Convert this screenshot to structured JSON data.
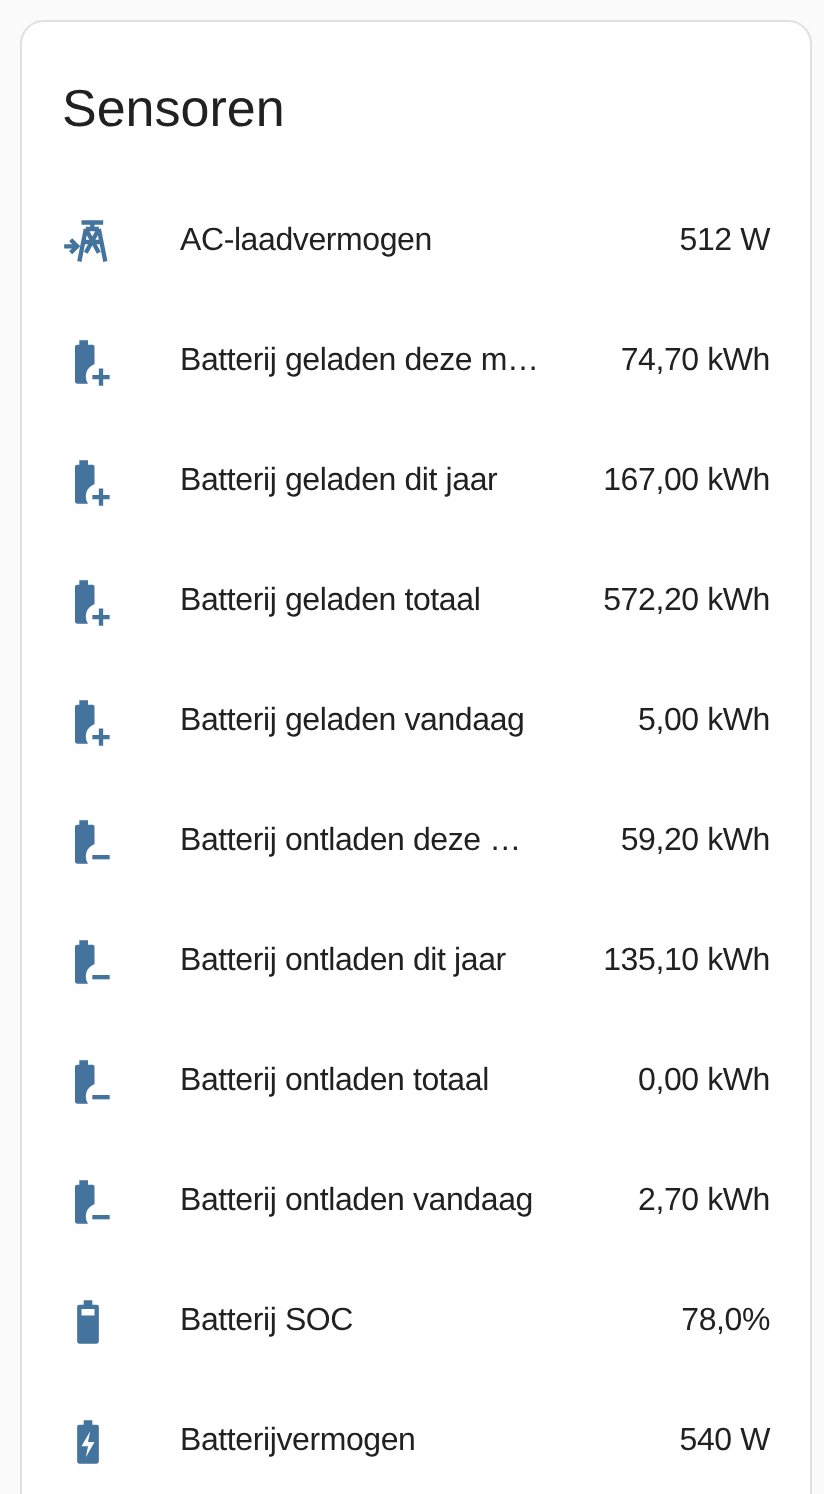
{
  "card": {
    "title": "Sensoren",
    "rows": [
      {
        "kind": "tower",
        "name": "AC-laadvermogen",
        "value": "512 W"
      },
      {
        "kind": "charge",
        "name": "Batterij geladen deze m…",
        "value": "74,70 kWh"
      },
      {
        "kind": "charge",
        "name": "Batterij geladen dit jaar",
        "value": "167,00 kWh"
      },
      {
        "kind": "charge",
        "name": "Batterij geladen totaal",
        "value": "572,20 kWh"
      },
      {
        "kind": "charge",
        "name": "Batterij geladen vandaag",
        "value": "5,00 kWh"
      },
      {
        "kind": "discharge",
        "name": "Batterij ontladen deze …",
        "value": "59,20 kWh"
      },
      {
        "kind": "discharge",
        "name": "Batterij ontladen dit jaar",
        "value": "135,10 kWh"
      },
      {
        "kind": "discharge",
        "name": "Batterij ontladen totaal",
        "value": "0,00 kWh"
      },
      {
        "kind": "discharge",
        "name": "Batterij ontladen vandaag",
        "value": "2,70 kWh"
      },
      {
        "kind": "level",
        "name": "Batterij SOC",
        "value": "78,0%"
      },
      {
        "kind": "charging",
        "name": "Batterijvermogen",
        "value": "540 W"
      }
    ]
  }
}
